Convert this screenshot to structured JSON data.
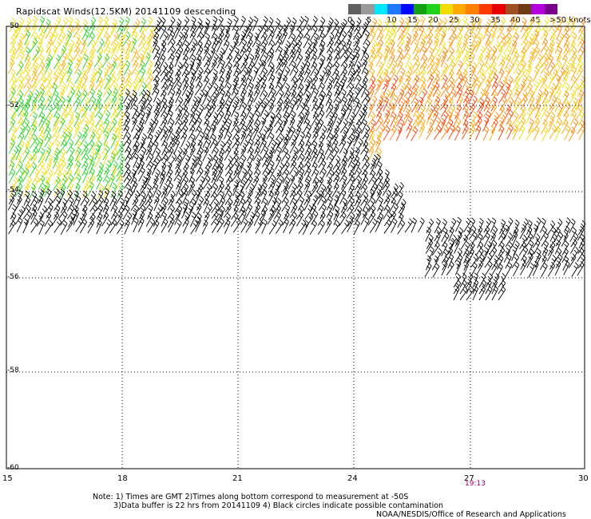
{
  "title": "Rapidscat Winds(12.5KM) 20141109 descending",
  "legend": {
    "labels": [
      "0",
      "5",
      "10",
      "15",
      "20",
      "25",
      "30",
      "35",
      "40",
      "45",
      ">50 knots"
    ],
    "colors": [
      "#606060",
      "#9a9a9a",
      "#00e6ff",
      "#1e78ff",
      "#0008ff",
      "#14a014",
      "#1ed21e",
      "#f0dc00",
      "#ffaa00",
      "#ff7f00",
      "#ff3a00",
      "#e60000",
      "#a05020",
      "#6e3c14",
      "#b400dc",
      "#78008c"
    ]
  },
  "map": {
    "x_ticks": [
      "15",
      "18",
      "21",
      "24",
      "27",
      "30"
    ],
    "y_ticks": [
      "-50",
      "-52",
      "-54",
      "-56",
      "-58",
      "-60"
    ],
    "lon_range": [
      15,
      30
    ],
    "lat_range": [
      -60,
      -50
    ],
    "time_label": "19:13",
    "time_color": "#a00078"
  },
  "notes": {
    "line1": "Note: 1) Times are GMT 2)Times along bottom correspond to measurement at -50S",
    "line2": "3)Data buffer is 22 hrs from 20141109 4) Black circles indicate possible contamination",
    "line3": "NOAA/NESDIS/Office of Research and Applications"
  }
}
